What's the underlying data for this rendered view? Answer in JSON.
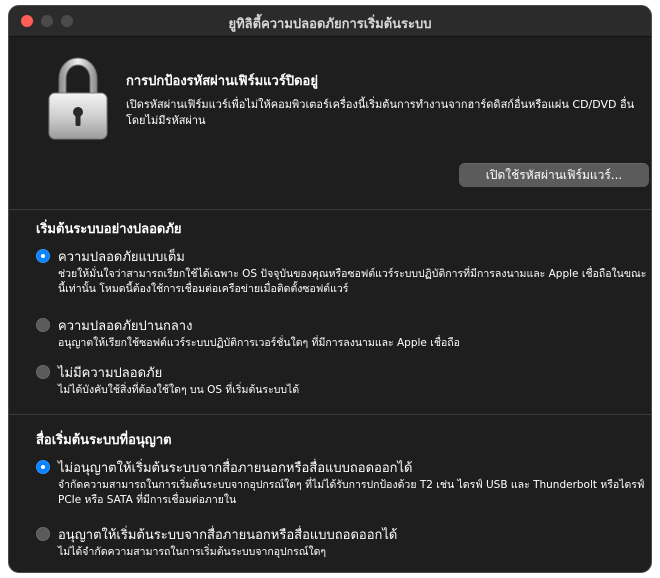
{
  "window": {
    "title": "ยูทิลิตี้ความปลอดภัยการเริ่มต้นระบบ"
  },
  "firmware": {
    "heading": "การปกป้องรหัสผ่านเฟิร์มแวร์ปิดอยู่",
    "description": "เปิดรหัสผ่านเฟิร์มแวร์เพื่อไม่ให้คอมพิวเตอร์เครื่องนี้เริ่มต้นการทำงานจากฮาร์ดดิสก์อื่นหรือแผ่น CD/DVD อื่นโดยไม่มีรหัสผ่าน",
    "button_label": "เปิดใช้รหัสผ่านเฟิร์มแวร์..."
  },
  "secure_boot": {
    "title": "เริ่มต้นระบบอย่างปลอดภัย",
    "options": [
      {
        "label": "ความปลอดภัยแบบเต็ม",
        "description": "ช่วยให้มั่นใจว่าสามารถเรียกใช้ได้เฉพาะ OS ปัจจุบันของคุณหรือซอฟต์แวร์ระบบปฏิบัติการที่มีการลงนามและ Apple เชื่อถือในขณะนี้เท่านั้น โหมดนี้ต้องใช้การเชื่อมต่อเครือข่ายเมื่อติดตั้งซอฟต์แวร์",
        "selected": true
      },
      {
        "label": "ความปลอดภัยปานกลาง",
        "description": "อนุญาตให้เรียกใช้ซอฟต์แวร์ระบบปฏิบัติการเวอร์ชั่นใดๆ ที่มีการลงนามและ Apple เชื่อถือ",
        "selected": false
      },
      {
        "label": "ไม่มีความปลอดภัย",
        "description": "ไม่ได้บังคับใช้สิ่งที่ต้องใช้ใดๆ บน OS ที่เริ่มต้นระบบได้",
        "selected": false
      }
    ]
  },
  "boot_media": {
    "title": "สื่อเริ่มต้นระบบที่อนุญาต",
    "options": [
      {
        "label": "ไม่อนุญาตให้เริ่มต้นระบบจากสื่อภายนอกหรือสื่อแบบถอดออกได้",
        "description": "จำกัดความสามารถในการเริ่มต้นระบบจากอุปกรณ์ใดๆ ที่ไม่ได้รับการปกป้องด้วย T2 เช่น ไดรฟ์ USB และ Thunderbolt หรือไดรฟ์ PCIe หรือ SATA ที่มีการเชื่อมต่อภายใน",
        "selected": true
      },
      {
        "label": "อนุญาตให้เริ่มต้นระบบจากสื่อภายนอกหรือสื่อแบบถอดออกได้",
        "description": "ไม่ได้จำกัดความสามารถในการเริ่มต้นระบบจากอุปกรณ์ใดๆ",
        "selected": false
      }
    ]
  },
  "colors": {
    "window_background": "#1e1e1e",
    "accent": "#0a84ff",
    "button": "#5b5b5b"
  },
  "icons": {
    "lock": "padlock-icon"
  }
}
